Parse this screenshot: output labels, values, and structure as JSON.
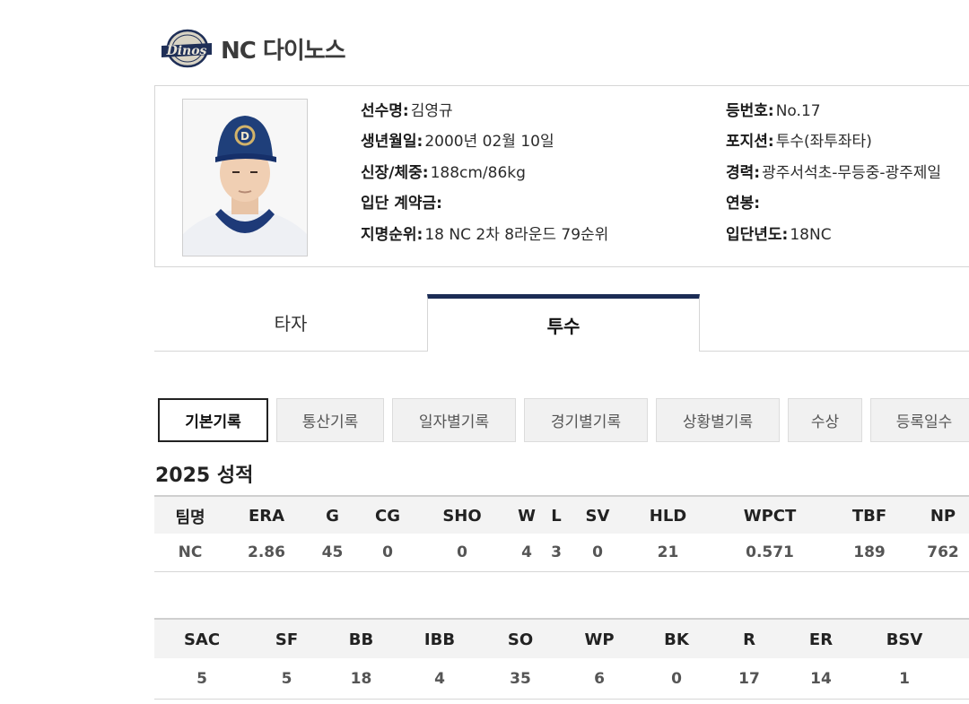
{
  "team": {
    "name": "NC 다이노스",
    "logo_text": "Dinos"
  },
  "player": {
    "left": [
      {
        "label": "선수명:",
        "value": "김영규"
      },
      {
        "label": "생년월일:",
        "value": "2000년 02월 10일"
      },
      {
        "label": "신장/체중:",
        "value": "188cm/86kg"
      },
      {
        "label": "입단 계약금:",
        "value": ""
      },
      {
        "label": "지명순위:",
        "value": "18 NC 2차 8라운드 79순위"
      }
    ],
    "right": [
      {
        "label": "등번호:",
        "value": "No.17"
      },
      {
        "label": "포지션:",
        "value": "투수(좌투좌타)"
      },
      {
        "label": "경력:",
        "value": "광주서석초-무등중-광주제일"
      },
      {
        "label": "연봉:",
        "value": ""
      },
      {
        "label": "입단년도:",
        "value": "18NC"
      }
    ]
  },
  "tabs": {
    "batter": "타자",
    "pitcher": "투수"
  },
  "subtabs": [
    "기본기록",
    "통산기록",
    "일자별기록",
    "경기별기록",
    "상황별기록",
    "수상",
    "등록일수"
  ],
  "season_title": "2025 성적",
  "table1": {
    "headers": [
      "팀명",
      "ERA",
      "G",
      "CG",
      "SHO",
      "W",
      "L",
      "SV",
      "HLD",
      "WPCT",
      "TBF",
      "NP"
    ],
    "values": [
      "NC",
      "2.86",
      "45",
      "0",
      "0",
      "4",
      "3",
      "0",
      "21",
      "0.571",
      "189",
      "762"
    ]
  },
  "table2": {
    "headers": [
      "SAC",
      "SF",
      "BB",
      "IBB",
      "SO",
      "WP",
      "BK",
      "R",
      "ER",
      "BSV"
    ],
    "values": [
      "5",
      "5",
      "18",
      "4",
      "35",
      "6",
      "0",
      "17",
      "14",
      "1"
    ]
  }
}
